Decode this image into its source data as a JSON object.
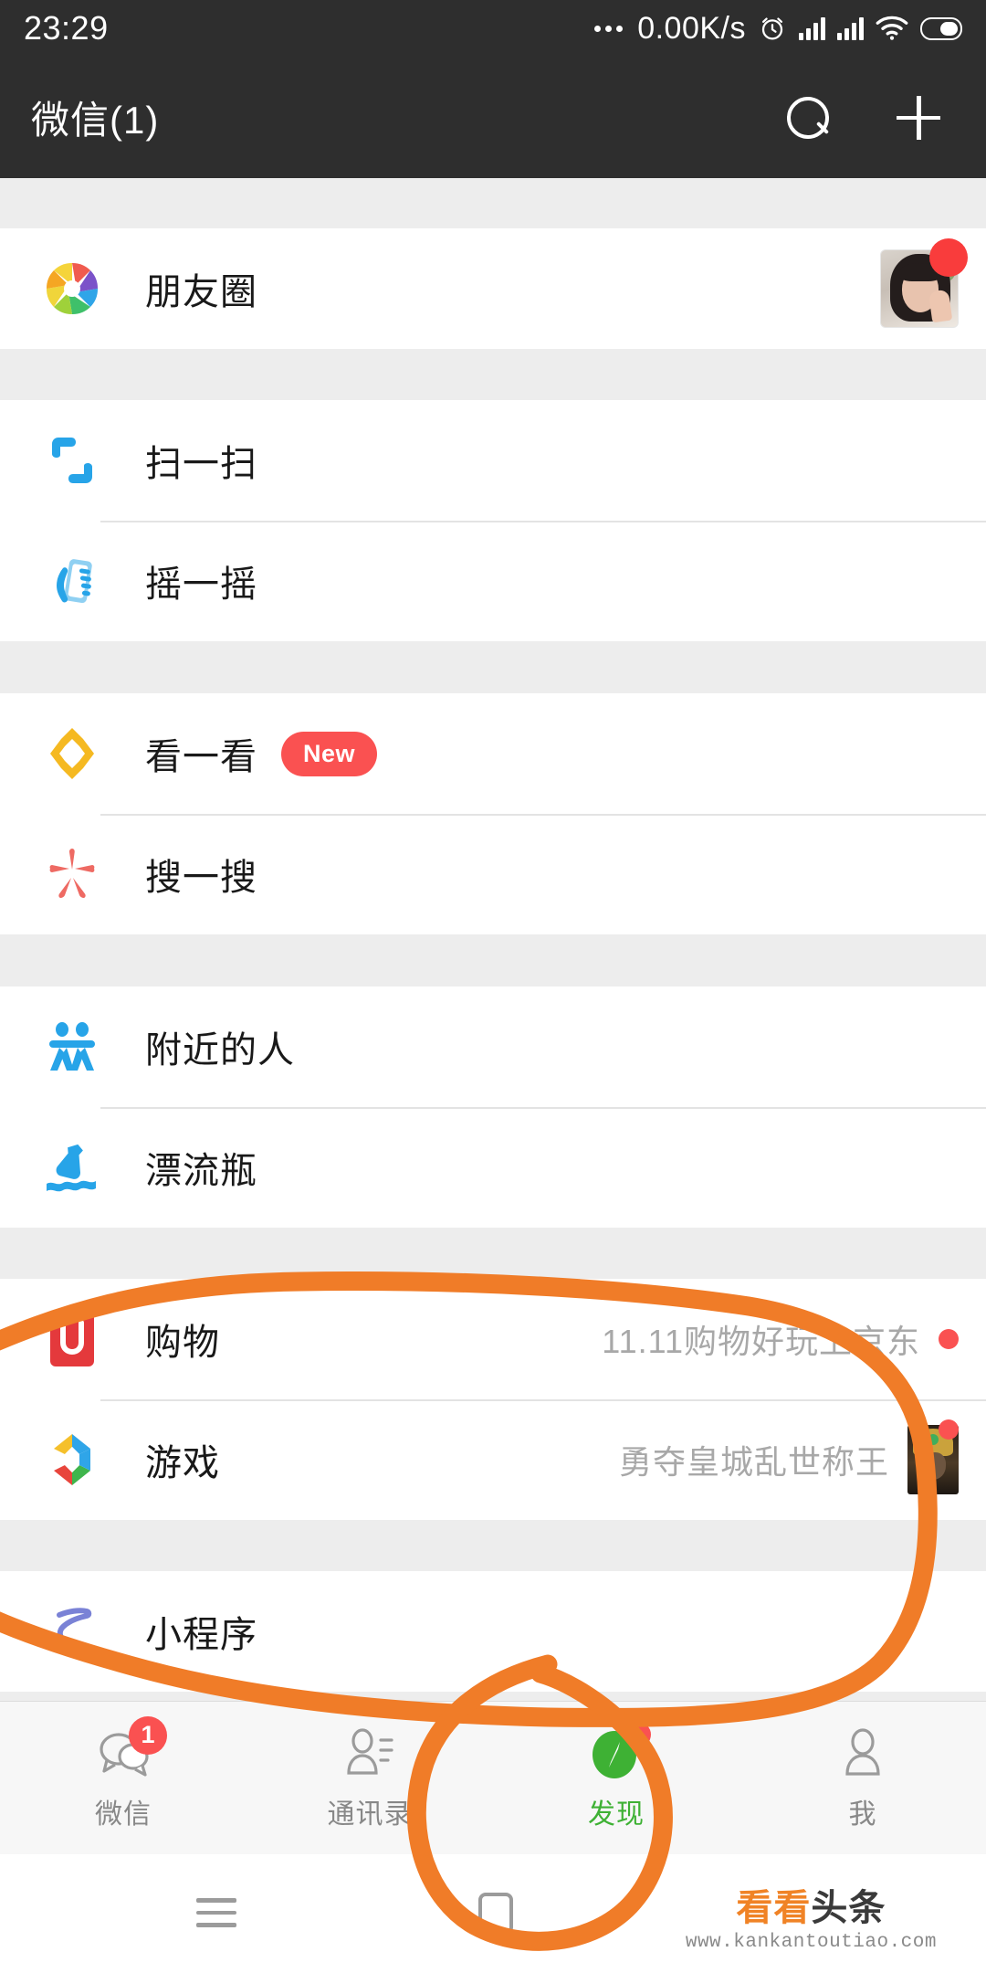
{
  "statusbar": {
    "time": "23:29",
    "network_speed": "0.00K/s",
    "icons": [
      "more-dots-icon",
      "alarm-clock-icon",
      "signal-bars-icon",
      "signal-bars-icon",
      "wifi-icon",
      "battery-icon"
    ]
  },
  "titlebar": {
    "title": "微信(1)",
    "search_icon": "search-icon",
    "add_icon": "plus-icon"
  },
  "groups": [
    {
      "rows": [
        {
          "label": "朋友圈",
          "icon": "moments-aperture-icon",
          "avatar": true,
          "avatar_dot": true
        }
      ]
    },
    {
      "rows": [
        {
          "label": "扫一扫",
          "icon": "scan-qr-icon"
        },
        {
          "label": "摇一摇",
          "icon": "shake-phone-icon"
        }
      ]
    },
    {
      "rows": [
        {
          "label": "看一看",
          "icon": "top-stories-icon",
          "badge": "New"
        },
        {
          "label": "搜一搜",
          "icon": "search-star-icon"
        }
      ]
    },
    {
      "rows": [
        {
          "label": "附近的人",
          "icon": "nearby-people-icon"
        },
        {
          "label": "漂流瓶",
          "icon": "drift-bottle-icon"
        }
      ]
    },
    {
      "rows": [
        {
          "label": "购物",
          "icon": "jd-shopping-icon",
          "subtitle": "11.11购物好玩上京东",
          "dot": true
        },
        {
          "label": "游戏",
          "icon": "games-icon",
          "subtitle": "勇夺皇城乱世称王",
          "thumb": true,
          "dot": true
        }
      ]
    },
    {
      "rows": [
        {
          "label": "小程序",
          "icon": "mini-program-icon"
        }
      ]
    }
  ],
  "tabbar": [
    {
      "label": "微信",
      "icon": "chat-bubbles-icon",
      "badge": "1",
      "active": false
    },
    {
      "label": "通讯录",
      "icon": "contacts-icon",
      "active": false
    },
    {
      "label": "发现",
      "icon": "compass-icon",
      "dot": true,
      "active": true
    },
    {
      "label": "我",
      "icon": "person-icon",
      "active": false
    }
  ],
  "navbar": {
    "menu_icon": "menu-icon",
    "home_icon": "home-square-icon"
  },
  "watermark": {
    "brand_orange": "看看",
    "brand_dark": "头条",
    "url": "www.kankantoutiao.com"
  },
  "annotation": {
    "color": "#f07c28",
    "shapes": [
      "hand-drawn-rounded-rectangle-around-shopping-games-miniprogram",
      "hand-drawn-ellipse-around-discover-tab"
    ]
  },
  "colors": {
    "header_bg": "#2e2e2e",
    "page_bg": "#ededed",
    "row_bg": "#ffffff",
    "accent_green": "#3eb134",
    "badge_red": "#fa5151",
    "subtitle_gray": "#a8a8a8",
    "annotation_orange": "#f07c28"
  }
}
